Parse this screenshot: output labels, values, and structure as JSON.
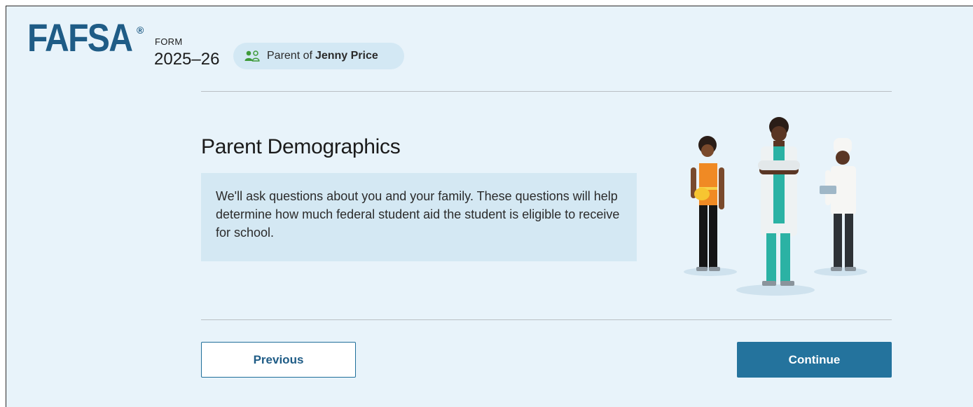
{
  "header": {
    "logo_text": "FAFSA",
    "registered_mark": "®",
    "form_label": "FORM",
    "form_year": "2025–26",
    "role_badge": {
      "prefix": "Parent of",
      "student_name": "Jenny Price",
      "icon": "people-icon"
    }
  },
  "main": {
    "title": "Parent Demographics",
    "description": "We'll ask questions about you and your family. These questions will help determine how much federal student aid the student is eligible to receive for school.",
    "illustration": "three-workers-illustration"
  },
  "actions": {
    "previous_label": "Previous",
    "continue_label": "Continue"
  },
  "colors": {
    "brand_blue": "#1f5c86",
    "primary_button": "#24739d",
    "page_background": "#e8f3fa",
    "callout_background": "#d4e8f3",
    "badge_icon_green": "#3f9a3a"
  }
}
